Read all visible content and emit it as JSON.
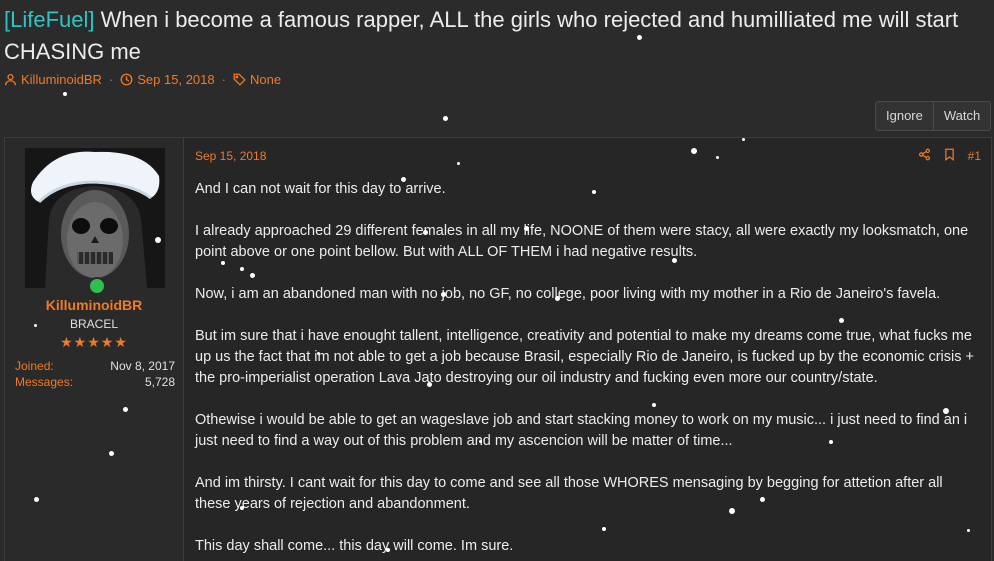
{
  "thread": {
    "prefix": "[LifeFuel]",
    "title": " When i become a famous rapper, ALL the girls who rejected and humilliated me will start CHASING me",
    "author": "KilluminoidBR",
    "date": "Sep 15, 2018",
    "tags": "None"
  },
  "actions": {
    "ignore": "Ignore",
    "watch": "Watch"
  },
  "user": {
    "name": "KilluminoidBR",
    "title": "BRACEL",
    "stars": "★★★★★",
    "joined_label": "Joined:",
    "joined_value": "Nov 8, 2017",
    "messages_label": "Messages:",
    "messages_value": "5,728"
  },
  "post": {
    "date": "Sep 15, 2018",
    "number": "#1",
    "paragraphs": [
      "And I can not wait for this day to arrive.",
      "I already approached 29 different females in all my life, NOONE of them were stacy, all were exactly my looksmatch, one point above or one point bellow. But with ALL OF THEM i had negative results.",
      "Now, i am an abandoned man with no job, no GF, no college, poor living with my mother in a Rio de Janeiro's favela.",
      "But im sure that i have enought tallent, intelligence, creativity and potential to make my dreams come true, what fucks me up us the fact that im not able to get a job because Brasil, especially Rio de Janeiro, is fucked up by the economic crisis + the pro-imperialist operation Lava Jato destroying our oil industry and fucking even more our country/state.",
      "Othewise i would be able to get an wageslave job and start stacking money to work on my music... i just need to find an i just need to find a way out of this problem and my ascencion will be matter of time...",
      "And im thirsty. I cant wait for this day to come and see all those WHORES mensaging by begging for attetion after all these years of rejection and abandonment.",
      "This day shall come... this day will come. Im sure."
    ]
  },
  "colors": {
    "accent": "#f07a28",
    "prefix": "#2ec4c4",
    "online": "#2fbe52",
    "background": "#2b2b2b"
  },
  "icons": [
    "user-icon",
    "clock-icon",
    "tag-icon",
    "share-icon",
    "bookmark-icon"
  ]
}
